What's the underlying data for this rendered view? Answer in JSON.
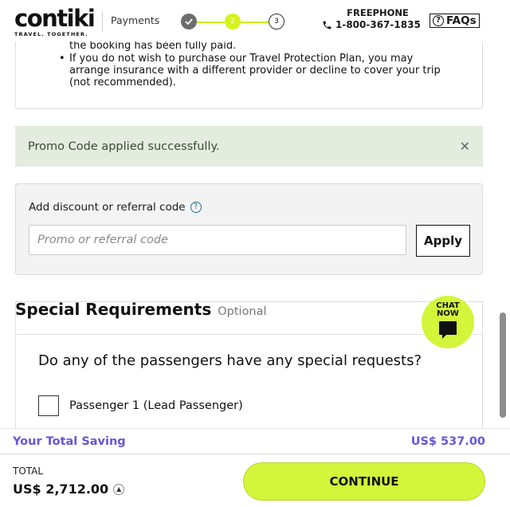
{
  "header": {
    "brand": "contiki",
    "tagline": "TRAVEL. TOGETHER.",
    "step_label": "Payments",
    "steps": [
      "",
      "2",
      "3"
    ],
    "phone_label": "FREEPHONE",
    "phone_number": "1-800-367-1835",
    "faqs_label": "FAQs"
  },
  "insurance": {
    "clipped_line": "the booking has been fully paid.",
    "bullet": "If you do not wish to purchase our Travel Protection Plan, you may arrange insurance with a different provider or decline to cover your trip (not recommended)."
  },
  "promo_alert": {
    "message": "Promo Code applied successfully.",
    "close": "✕"
  },
  "discount": {
    "label": "Add discount or referral code",
    "help": "?",
    "input_placeholder": "Promo or referral code",
    "apply_label": "Apply"
  },
  "special_requirements": {
    "title": "Special Requirements",
    "optional": "Optional",
    "question": "Do any of the passengers have any special requests?",
    "passenger_label": "Passenger 1 (Lead Passenger)"
  },
  "chat": {
    "line1": "CHAT",
    "line2": "NOW"
  },
  "savings": {
    "label": "Your Total Saving",
    "value": "US$ 537.00"
  },
  "footer": {
    "total_label": "TOTAL",
    "total_amount": "US$ 2,712.00",
    "continue_label": "CONTINUE"
  },
  "colors": {
    "accent": "#d3f53a",
    "savings": "#6357d8",
    "promo_bg": "#e4ecdf"
  }
}
